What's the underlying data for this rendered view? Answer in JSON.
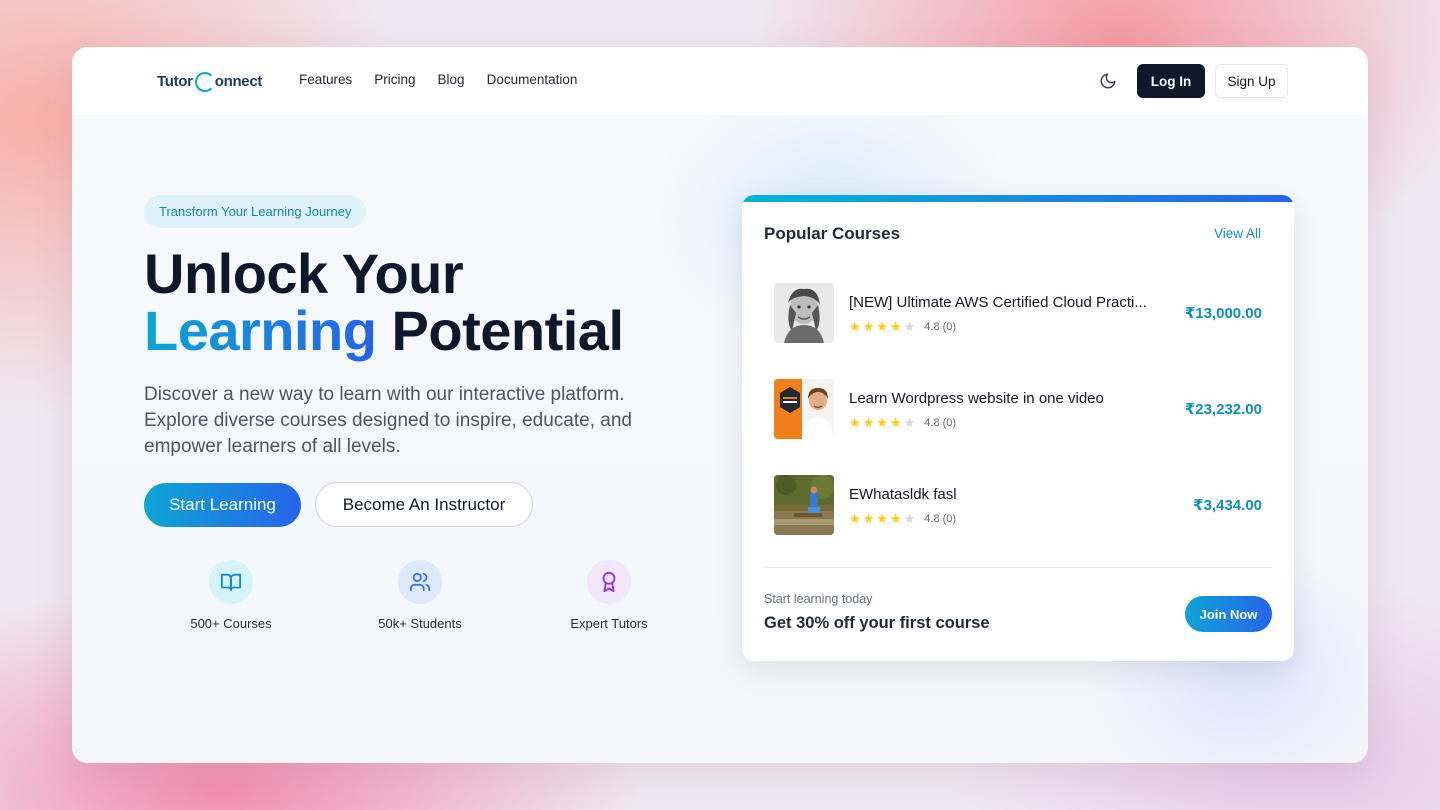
{
  "nav": {
    "logo_text_1": "Tutor",
    "logo_text_2": "onnect",
    "links": [
      "Features",
      "Pricing",
      "Blog",
      "Documentation"
    ],
    "theme_icon": "moon-icon",
    "login_label": "Log In",
    "signup_label": "Sign Up"
  },
  "hero": {
    "badge": "Transform Your Learning Journey",
    "headline_line1": "Unlock Your",
    "headline_highlight": "Learning",
    "headline_rest": " Potential",
    "subtext": "Discover a new way to learn with our interactive platform. Explore diverse courses designed to inspire, educate, and empower learners of all levels.",
    "primary_cta": "Start Learning",
    "secondary_cta": "Become An Instructor",
    "stats": [
      {
        "label": "500+ Courses",
        "icon": "book-open-icon",
        "color": "#0e8fc0",
        "bg": "#d6f3fa"
      },
      {
        "label": "50k+ Students",
        "icon": "users-icon",
        "color": "#3b6fe0",
        "bg": "#dde8fb"
      },
      {
        "label": "Expert Tutors",
        "icon": "award-icon",
        "color": "#9333ea",
        "bg": "#f1e6fb"
      }
    ]
  },
  "popular": {
    "title": "Popular Courses",
    "view_all": "View All",
    "courses": [
      {
        "title": "[NEW] Ultimate AWS Certified Cloud Practi...",
        "rating": "4.8 (0)",
        "stars": 4,
        "price": "₹13,000.00"
      },
      {
        "title": "Learn Wordpress website in one video",
        "rating": "4.8 (0)",
        "stars": 4,
        "price": "₹23,232.00"
      },
      {
        "title": "EWhatasldk fasl",
        "rating": "4.8 (0)",
        "stars": 4,
        "price": "₹3,434.00"
      }
    ],
    "promo_small": "Start learning today",
    "promo_big": "Get 30% off your first course",
    "join_label": "Join Now"
  },
  "colors": {
    "accent": "#0ea5d6",
    "accent_end": "#2563eb",
    "dark_button": "#0f172a",
    "price": "#0e8fc0"
  }
}
